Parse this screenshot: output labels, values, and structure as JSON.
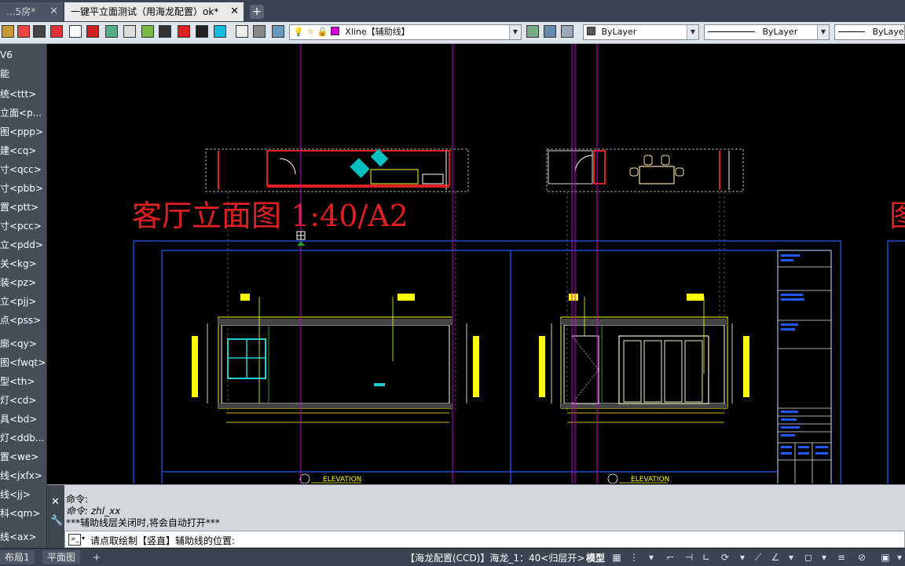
{
  "tabs": [
    {
      "label": "...5房*",
      "active": false
    },
    {
      "label": "一键平立面测试（用海龙配置）ok*",
      "active": true
    }
  ],
  "toolbar": {
    "layer_value": "Xline【辅助线】",
    "color_value": "ByLayer",
    "linetype_value": "ByLayer",
    "lineweight_value": "ByLayer",
    "accent_layer_color": "#d000d0"
  },
  "left_panel": {
    "items": [
      "V6",
      "能",
      "统<ttt>",
      "立面<p...",
      "图<ppp>",
      "建<cq>",
      "寸<qcc>",
      "寸<pbb>",
      "置<ptt>",
      "寸<pcc>",
      "立<pdd>",
      "关<kg>",
      "装<pz>",
      "立<pjj>",
      "点<pss>",
      "廓<qy>",
      "图<fwqt>",
      "型<th>",
      "灯<cd>",
      "具<bd>",
      "灯<ddb...",
      "置<we>",
      "线<jxfx>",
      "线<jj>",
      "科<qm>",
      "线<ax>"
    ]
  },
  "drawing": {
    "title_main": "客厅立面图 1:40/A2",
    "title_partial": "图",
    "elevation_label_1": "ELEVATION",
    "elevation_label_2": "ELEVATION"
  },
  "command": {
    "history": [
      "命令:",
      "命令: zhl_xx",
      "***辅助线层关闭时,将会自动打开***"
    ],
    "prompt": "请点取绘制【竖直】辅助线的位置:"
  },
  "status": {
    "layout_tabs": [
      "布局1",
      "平面图"
    ],
    "config_text": "【海龙配置(CCD)】海龙_1：40<归层开>",
    "model_label": "模型"
  }
}
